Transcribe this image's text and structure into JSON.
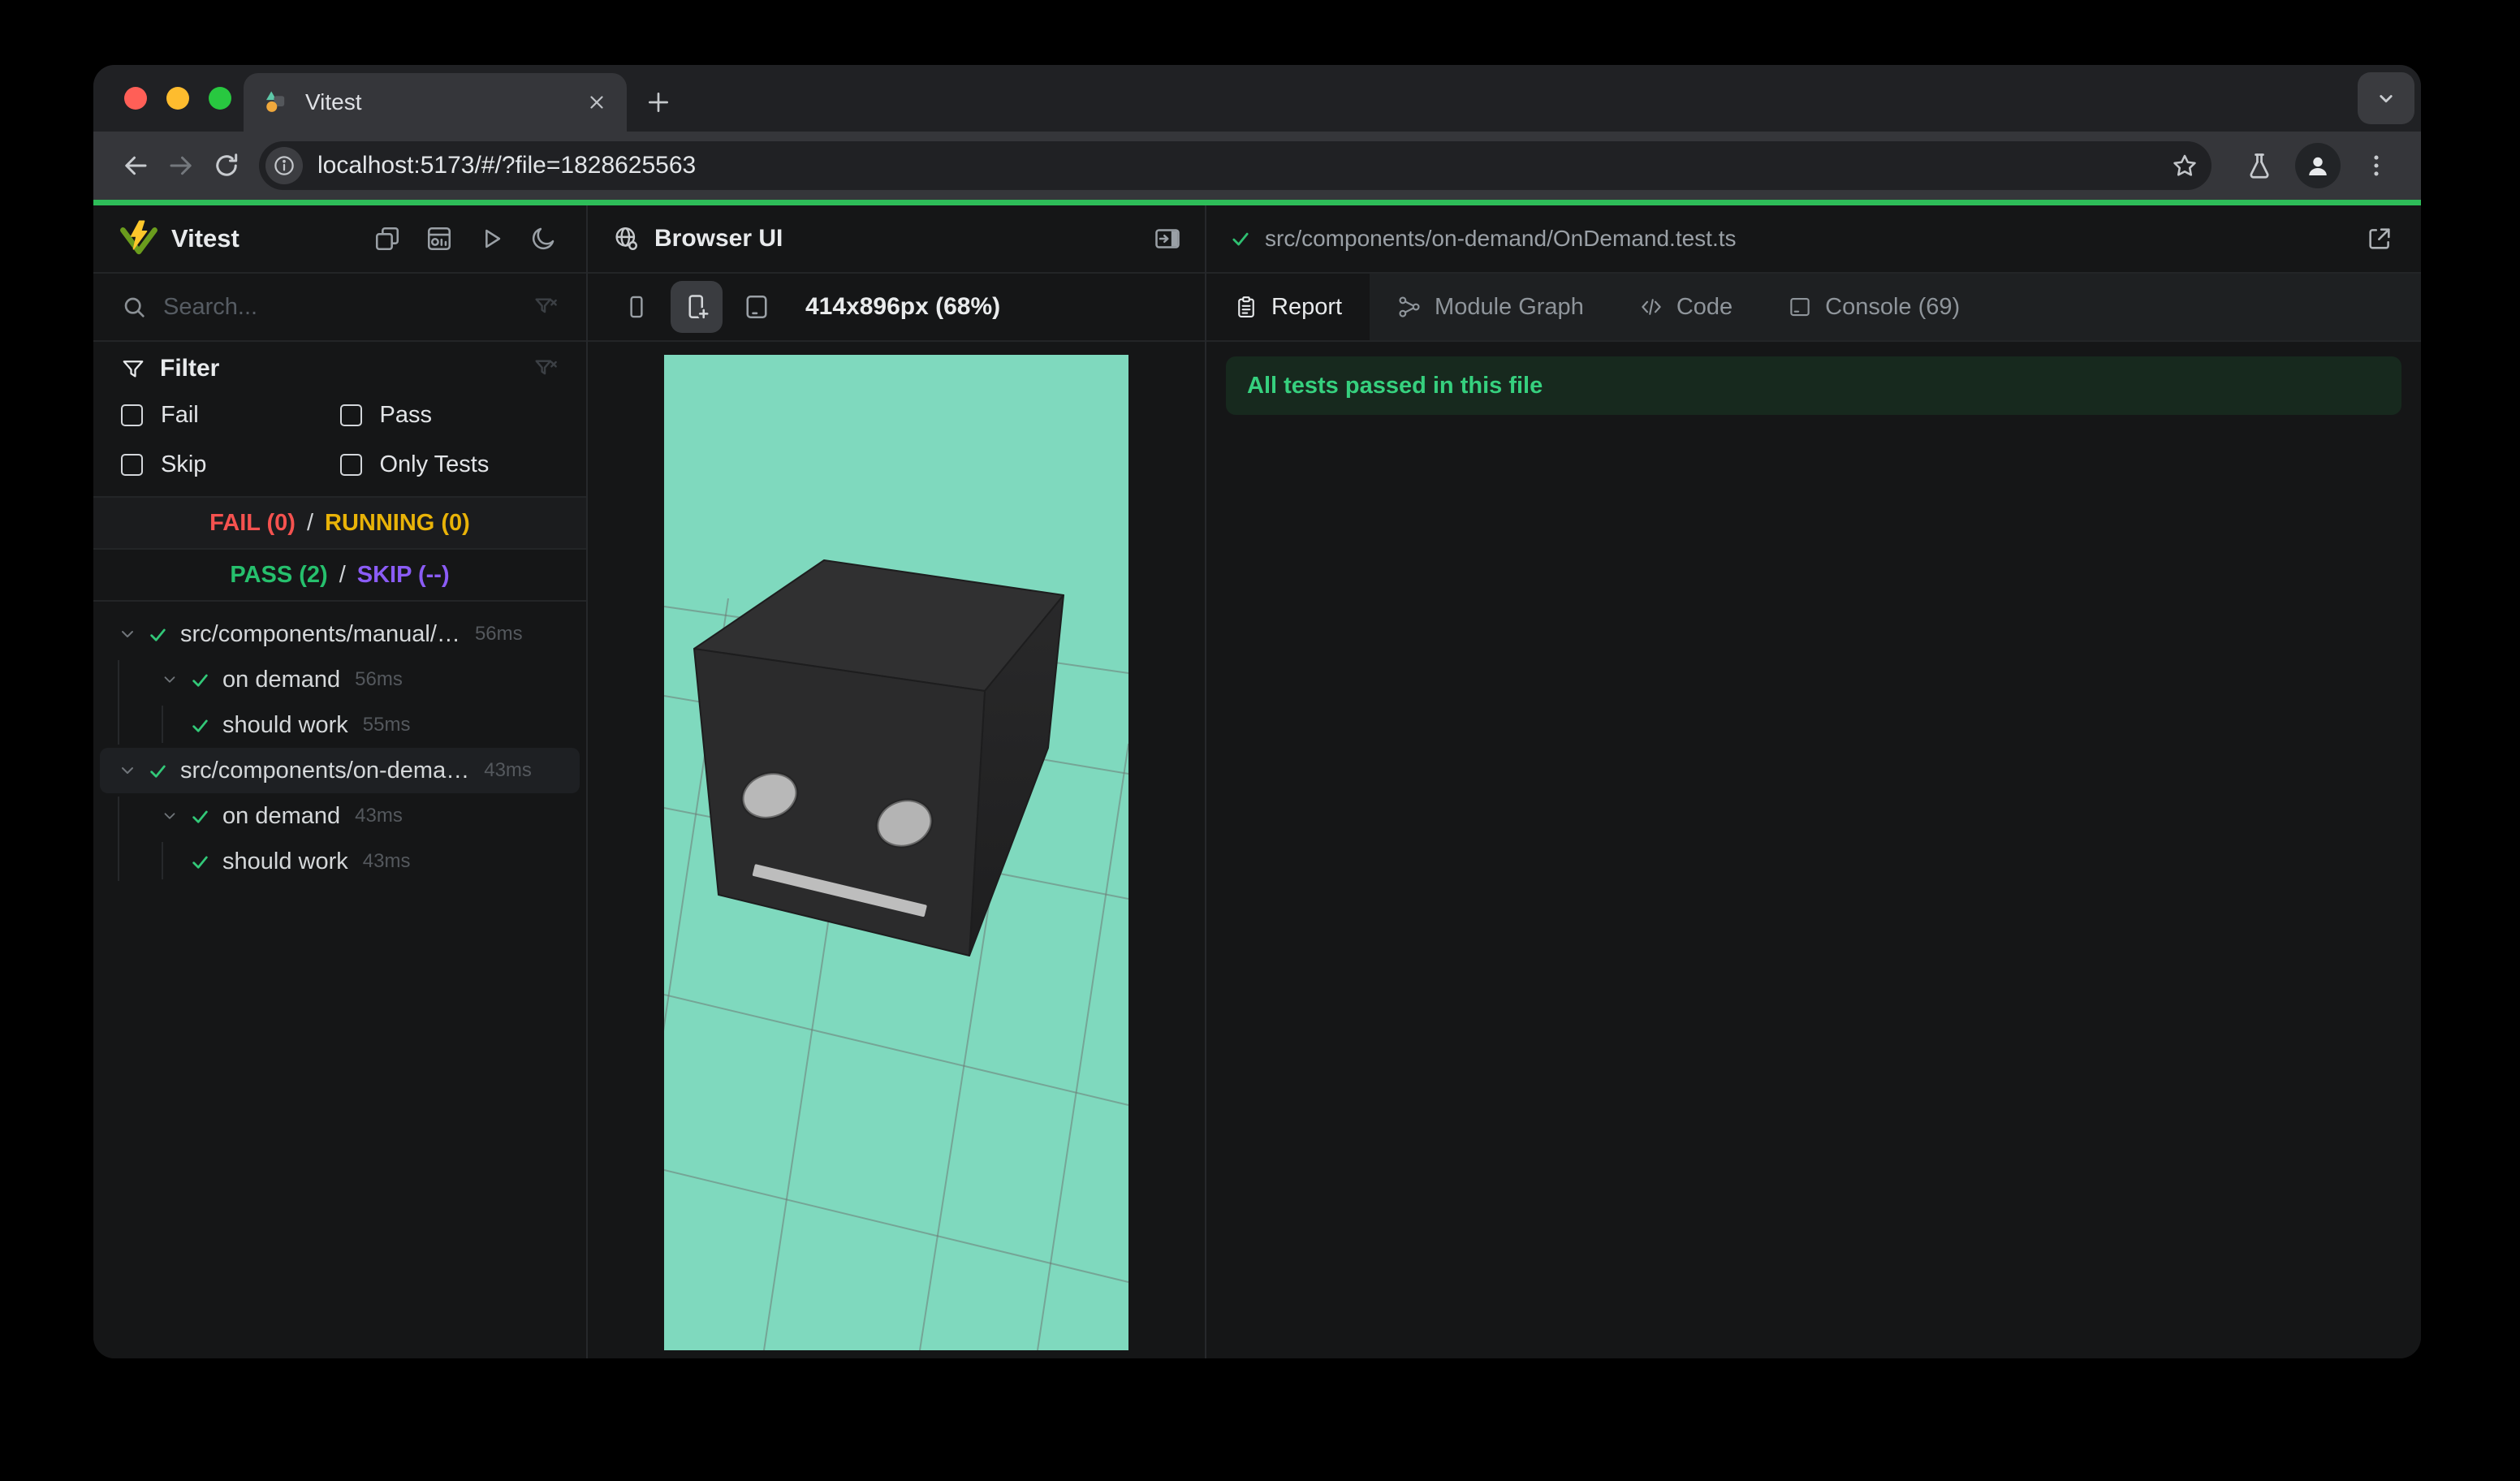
{
  "colors": {
    "accent_green": "#2ebd59",
    "viewport_mint": "#7fd9be",
    "fail_red": "#f5524f",
    "running_yellow": "#e9b308",
    "pass_green": "#26c06d",
    "skip_purple": "#8b5cf6",
    "tree_check_green": "#32c878",
    "banner_bg": "#17291e",
    "banner_text": "#36d07e"
  },
  "browser": {
    "tab_title": "Vitest",
    "url": "localhost:5173/#/?file=1828625563"
  },
  "sidebar": {
    "title": "Vitest",
    "search_placeholder": "Search...",
    "filter": {
      "title": "Filter",
      "options": [
        {
          "label": "Fail",
          "checked": false
        },
        {
          "label": "Pass",
          "checked": false
        },
        {
          "label": "Skip",
          "checked": false
        },
        {
          "label": "Only Tests",
          "checked": false
        }
      ]
    },
    "status": {
      "fail": "FAIL (0)",
      "running": "RUNNING (0)",
      "pass": "PASS (2)",
      "skip": "SKIP (--)",
      "sep": "/"
    },
    "tree": [
      {
        "label": "src/components/manual/…",
        "duration": "56ms",
        "level": 0,
        "type": "file"
      },
      {
        "label": "on demand",
        "duration": "56ms",
        "level": 1,
        "type": "suite"
      },
      {
        "label": "should work",
        "duration": "55ms",
        "level": 2,
        "type": "test"
      },
      {
        "label": "src/components/on-dema…",
        "duration": "43ms",
        "level": 0,
        "type": "file",
        "selected": true
      },
      {
        "label": "on demand",
        "duration": "43ms",
        "level": 1,
        "type": "suite"
      },
      {
        "label": "should work",
        "duration": "43ms",
        "level": 2,
        "type": "test"
      }
    ]
  },
  "browser_panel": {
    "title": "Browser UI",
    "dimensions": "414x896px (68%)"
  },
  "report_panel": {
    "file": "src/components/on-demand/OnDemand.test.ts",
    "tabs": [
      {
        "label": "Report",
        "active": true
      },
      {
        "label": "Module Graph",
        "active": false
      },
      {
        "label": "Code",
        "active": false
      },
      {
        "label": "Console (69)",
        "active": false
      }
    ],
    "banner": "All tests passed in this file"
  }
}
